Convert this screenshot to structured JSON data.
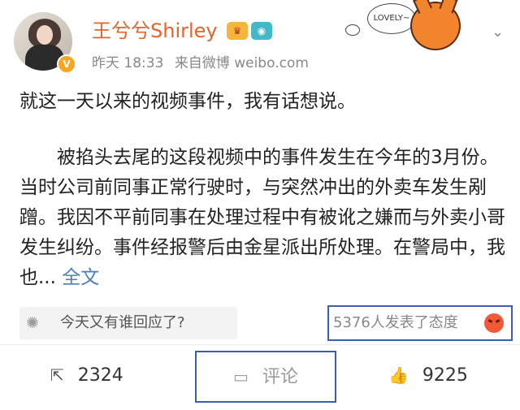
{
  "post": {
    "user": {
      "name": "王兮兮Shirley",
      "verified_badge": "V",
      "icons": [
        "crown-badge-icon",
        "camera-badge-icon"
      ]
    },
    "meta": {
      "time": "昨天 18:33",
      "source": "来自微博 weibo.com"
    },
    "sticker": {
      "text": "LOVELY~"
    },
    "body": {
      "paragraph1": "就这一天以来的视频事件，我有话想说。",
      "paragraph2": "被掐头去尾的这段视频中的事件发生在今年的3月份。当时公司前同事正常行驶时，与突然冲出的外卖车发生剐蹭。我因不平前同事在处理过程中有被讹之嫌而与外卖小哥发生纠纷。事件经报警后由金星派出所处理。在警局中，我也...",
      "full_link": "全文"
    },
    "topic": {
      "text": "今天又有谁回应了?"
    },
    "attitude": {
      "text": "5376人发表了态度"
    },
    "actions": {
      "repost": "2324",
      "comment": "评论",
      "like": "9225"
    }
  },
  "colors": {
    "username": "#e8622a",
    "link": "#4f7dbb",
    "highlight_box": "#3a5fae",
    "meta": "#888888"
  }
}
